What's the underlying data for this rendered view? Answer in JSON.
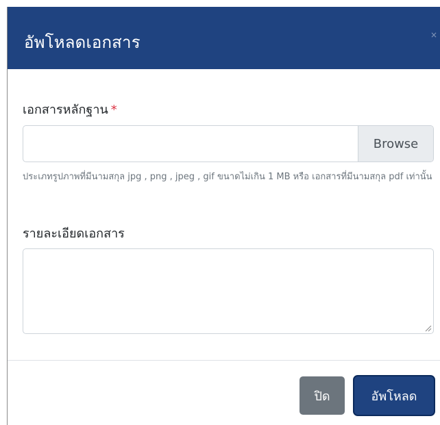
{
  "modal": {
    "title": "อัพโหลดเอกสาร",
    "close_icon": "close-icon",
    "close_glyph": "×"
  },
  "form": {
    "evidence_label": "เอกสารหลักฐาน",
    "required_mark": "*",
    "file_input_value": "",
    "browse_label": "Browse",
    "help_text": "ประเภทรูปภาพที่มีนามสกุล jpg , png , jpeg , gif ขนาดไม่เกิน 1 MB หรือ เอกสารที่มีนามสกุล pdf เท่านั้น",
    "detail_label": "รายละเอียดเอกสาร",
    "detail_value": ""
  },
  "footer": {
    "close_label": "ปิด",
    "upload_label": "อัพโหลด"
  },
  "colors": {
    "header_bg": "#1f4380",
    "primary": "#1f4380",
    "secondary": "#6c757d",
    "required": "#dc3545"
  }
}
